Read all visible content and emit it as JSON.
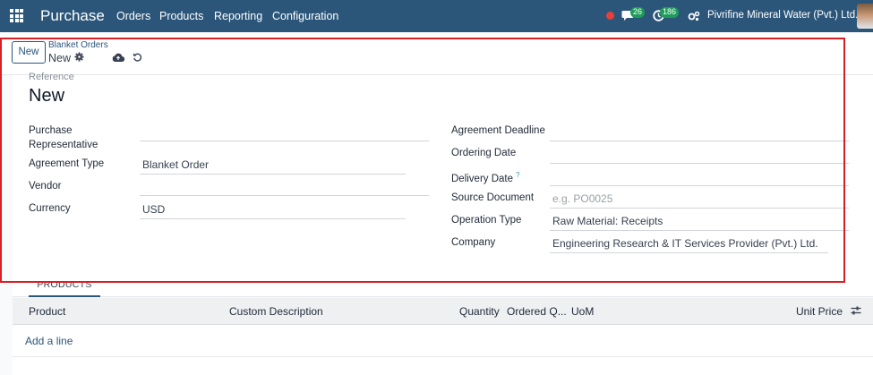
{
  "navbar": {
    "brand": "Purchase",
    "menu": [
      "Orders",
      "Products",
      "Reporting",
      "Configuration"
    ],
    "messages_count": "26",
    "activities_count": "186",
    "company": "Pivrifine Mineral Water (Pvt.) Ltd."
  },
  "control": {
    "new_label": "New",
    "breadcrumb_parent": "Blanket Orders",
    "breadcrumb_current": "New"
  },
  "form": {
    "reference_label": "Reference",
    "reference_value": "New",
    "left": {
      "purchase_rep_label": "Purchase Representative",
      "purchase_rep_value": "",
      "agreement_type_label": "Agreement Type",
      "agreement_type_value": "Blanket Order",
      "vendor_label": "Vendor",
      "vendor_value": "",
      "currency_label": "Currency",
      "currency_value": "USD"
    },
    "right": {
      "deadline_label": "Agreement Deadline",
      "deadline_value": "",
      "ordering_date_label": "Ordering Date",
      "ordering_date_value": "",
      "delivery_date_label": "Delivery Date",
      "delivery_date_help": "?",
      "delivery_date_value": "",
      "source_document_label": "Source Document",
      "source_document_placeholder": "e.g. PO0025",
      "operation_type_label": "Operation Type",
      "operation_type_value": "Raw Material: Receipts",
      "company_label": "Company",
      "company_value": "Engineering Research & IT Services Provider (Pvt.) Ltd."
    }
  },
  "notebook": {
    "tab_products": "PRODUCTS"
  },
  "table": {
    "columns": [
      "Product",
      "Custom Description",
      "Quantity",
      "Ordered Q...",
      "UoM",
      "Unit Price"
    ],
    "add_line": "Add a line"
  },
  "colors": {
    "navbar": "#2b567a",
    "accent": "#2b567a",
    "badge": "#1f9b5a",
    "highlight": "#d81f26"
  }
}
